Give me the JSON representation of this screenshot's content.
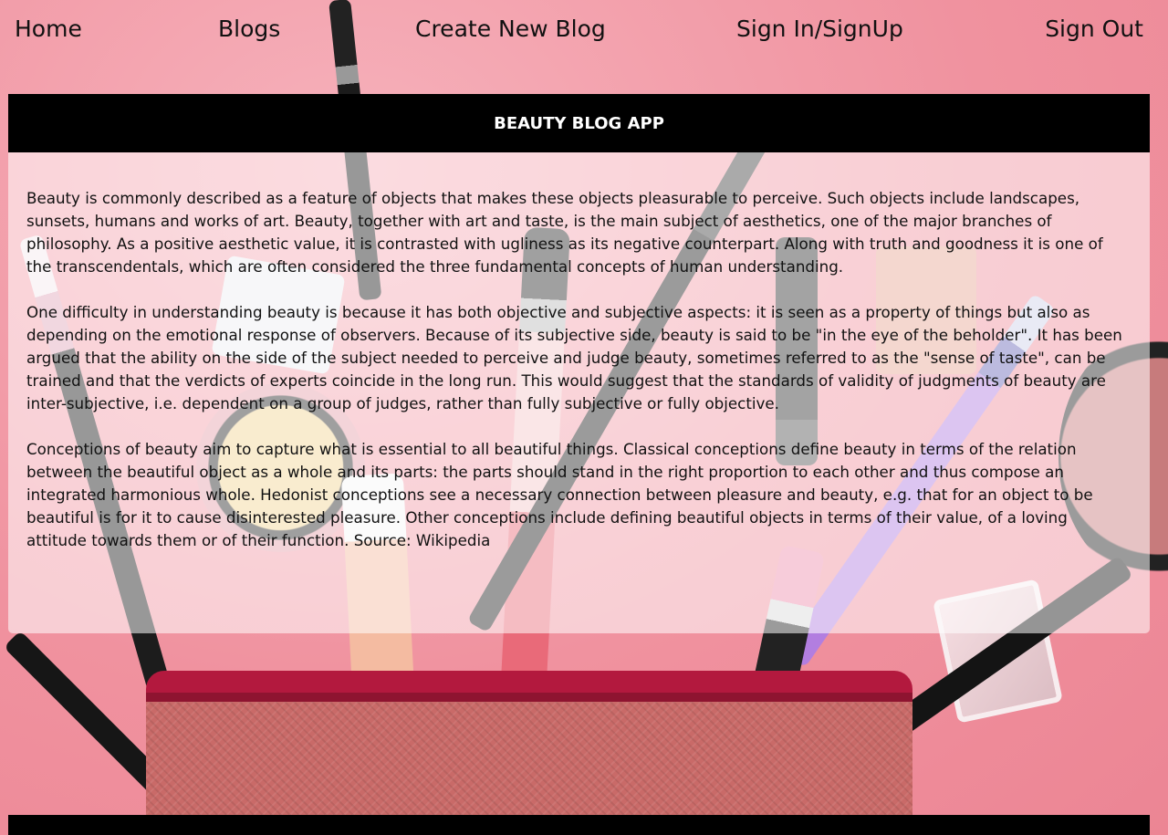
{
  "nav": {
    "home": "Home",
    "blogs": "Blogs",
    "create_new_blog": "Create New Blog",
    "sign_in_signup": "Sign In/SignUp",
    "sign_out": "Sign Out"
  },
  "card": {
    "title": "BEAUTY BLOG APP",
    "paragraphs": [
      "Beauty is commonly described as a feature of objects that makes these objects pleasurable to perceive. Such objects include landscapes, sunsets, humans and works of art. Beauty, together with art and taste, is the main subject of aesthetics, one of the major branches of philosophy. As a positive aesthetic value, it is contrasted with ugliness as its negative counterpart. Along with truth and goodness it is one of the transcendentals, which are often considered the three fundamental concepts of human understanding.",
      "One difficulty in understanding beauty is because it has both objective and subjective aspects: it is seen as a property of things but also as depending on the emotional response of observers. Because of its subjective side, beauty is said to be \"in the eye of the beholder\". It has been argued that the ability on the side of the subject needed to perceive and judge beauty, sometimes referred to as the \"sense of taste\", can be trained and that the verdicts of experts coincide in the long run. This would suggest that the standards of validity of judgments of beauty are inter-subjective, i.e. dependent on a group of judges, rather than fully subjective or fully objective.",
      "Conceptions of beauty aim to capture what is essential to all beautiful things. Classical conceptions define beauty in terms of the relation between the beautiful object as a whole and its parts: the parts should stand in the right proportion to each other and thus compose an integrated harmonious whole. Hedonist conceptions see a necessary connection between pleasure and beauty, e.g. that for an object to be beautiful is for it to cause disinterested pleasure. Other conceptions include defining beautiful objects in terms of their value, of a loving attitude towards them or of their function. Source: Wikipedia"
    ]
  },
  "colors": {
    "background_pink": "#f19aa6",
    "header_black": "#000000",
    "header_text": "#ffffff"
  }
}
